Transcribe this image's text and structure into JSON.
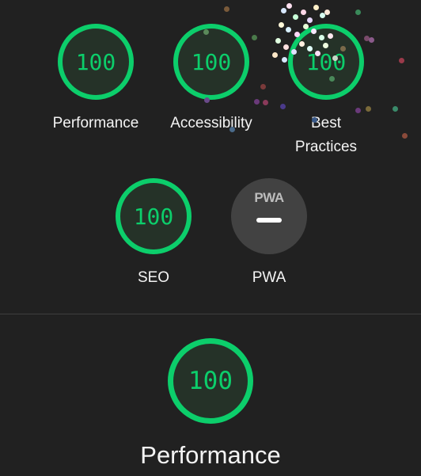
{
  "categories": [
    {
      "id": "performance",
      "score": "100",
      "label": "Performance"
    },
    {
      "id": "accessibility",
      "score": "100",
      "label": "Accessibility"
    },
    {
      "id": "best-practices",
      "score": "100",
      "label_line1": "Best",
      "label_line2": "Practices"
    },
    {
      "id": "seo",
      "score": "100",
      "label": "SEO"
    }
  ],
  "pwa": {
    "badge_text": "PWA",
    "label": "PWA"
  },
  "detail": {
    "score": "100",
    "title": "Performance"
  },
  "colors": {
    "background": "#212121",
    "pass": "#0cce6b",
    "pass_fill": "#253228",
    "pwa_badge": "#424242",
    "text": "#f4f4f4"
  }
}
